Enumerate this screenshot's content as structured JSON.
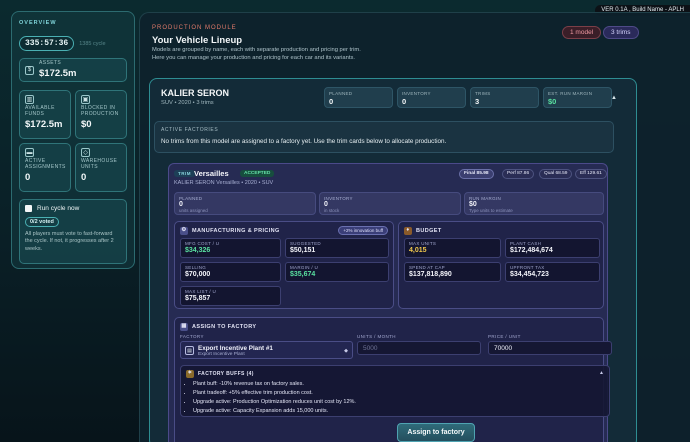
{
  "build_tag": "VER 0.1A , Build Name - APLH",
  "sidebar": {
    "title": "OVERVIEW",
    "timer": "335:57:36",
    "timer_sub": "1385 cycle",
    "assets": {
      "label": "ASSETS",
      "value": "$172.5m"
    },
    "available_funds": {
      "label": "AVAILABLE FUNDS",
      "value": "$172.5m"
    },
    "blocked": {
      "label": "BLOCKED IN PRODUCTION",
      "value": "$0"
    },
    "active_assignments": {
      "label": "ACTIVE ASSIGNMENTS",
      "value": "0"
    },
    "warehouse": {
      "label": "WAREHOUSE UNITS",
      "value": "0"
    },
    "run_cycle": {
      "label": "Run cycle now",
      "voted": "0/2 voted",
      "desc": "All players must vote to fast-forward the cycle. If not, it progresses after 2 weeks."
    }
  },
  "main": {
    "module_label": "PRODUCTION MODULE",
    "title": "Your Vehicle Lineup",
    "description": "Models are grouped by name, each with separate production and pricing per trim. Here you can manage your production and pricing for each car and its variants.",
    "pill_model": "1 model",
    "pill_trims": "3 trims"
  },
  "model": {
    "name": "KALIER SERON",
    "sub": "SUV • 2020 • 3 trims",
    "stats": [
      {
        "label": "PLANNED",
        "value": "0"
      },
      {
        "label": "INVENTORY",
        "value": "0"
      },
      {
        "label": "TRIMS",
        "value": "3"
      },
      {
        "label": "EST. RUN MARGIN",
        "value": "$0"
      }
    ],
    "collapse_icon": "chevron-up-icon",
    "factories_title": "ACTIVE FACTORIES",
    "factories_text": "No trims from this model are assigned to a factory yet. Use the trim cards below to allocate production."
  },
  "trim": {
    "badge": "TRIM",
    "name": "Versailles",
    "status": "ACCEPTED",
    "sub": "KALIER SERON Versailles • 2020 • SUV",
    "scores": {
      "final": "Final 85.98",
      "perf": "Perf 87.86",
      "qual": "Qual 68.59",
      "eff": "Eff 129.61"
    },
    "planned": {
      "label": "PLANNED",
      "value": "0",
      "sub": "units assigned"
    },
    "inventory": {
      "label": "INVENTORY",
      "value": "0",
      "sub": "in stock"
    },
    "run_margin": {
      "label": "RUN MARGIN",
      "value": "$0",
      "sub": "Type units to estimate"
    }
  },
  "manufacturing": {
    "title": "MANUFACTURING & PRICING",
    "buff": "+2% innovation buff",
    "mfg_cost": {
      "label": "MFG COST / U",
      "value": "$34,326"
    },
    "suggested": {
      "label": "SUGGESTED",
      "value": "$50,151"
    },
    "selling": {
      "label": "SELLING",
      "value": "$70,000"
    },
    "margin": {
      "label": "MARGIN / U",
      "value": "$35,674"
    },
    "max_list": {
      "label": "MAX LIST / U",
      "value": "$75,857"
    }
  },
  "budget": {
    "title": "BUDGET",
    "max_units": {
      "label": "MAX UNITS",
      "value": "4,015"
    },
    "plant_cash": {
      "label": "PLANT CASH",
      "value": "$172,484,674"
    },
    "spend_at_cap": {
      "label": "SPEND AT CAP",
      "value": "$137,818,890"
    },
    "upfront_tax": {
      "label": "UPFRONT TAX",
      "value": "$34,454,723"
    }
  },
  "assign": {
    "title": "ASSIGN TO FACTORY",
    "factory_label": "FACTORY",
    "factory_name": "Export Incentive Plant #1",
    "factory_sub": "Export Incentive Plant",
    "units_label": "UNITS / MONTH",
    "units_placeholder": "5000",
    "price_label": "PRICE / UNIT",
    "price_value": "70000",
    "buffs_title": "FACTORY BUFFS (4)",
    "buffs": [
      "Plant buff: -10% revenue tax on factory sales.",
      "Plant tradeoff: +5% effective trim production cost.",
      "Upgrade active: Production Optimization reduces unit cost by 12%.",
      "Upgrade active: Capacity Expansion adds 15,000 units."
    ],
    "button": "Assign to factory"
  }
}
